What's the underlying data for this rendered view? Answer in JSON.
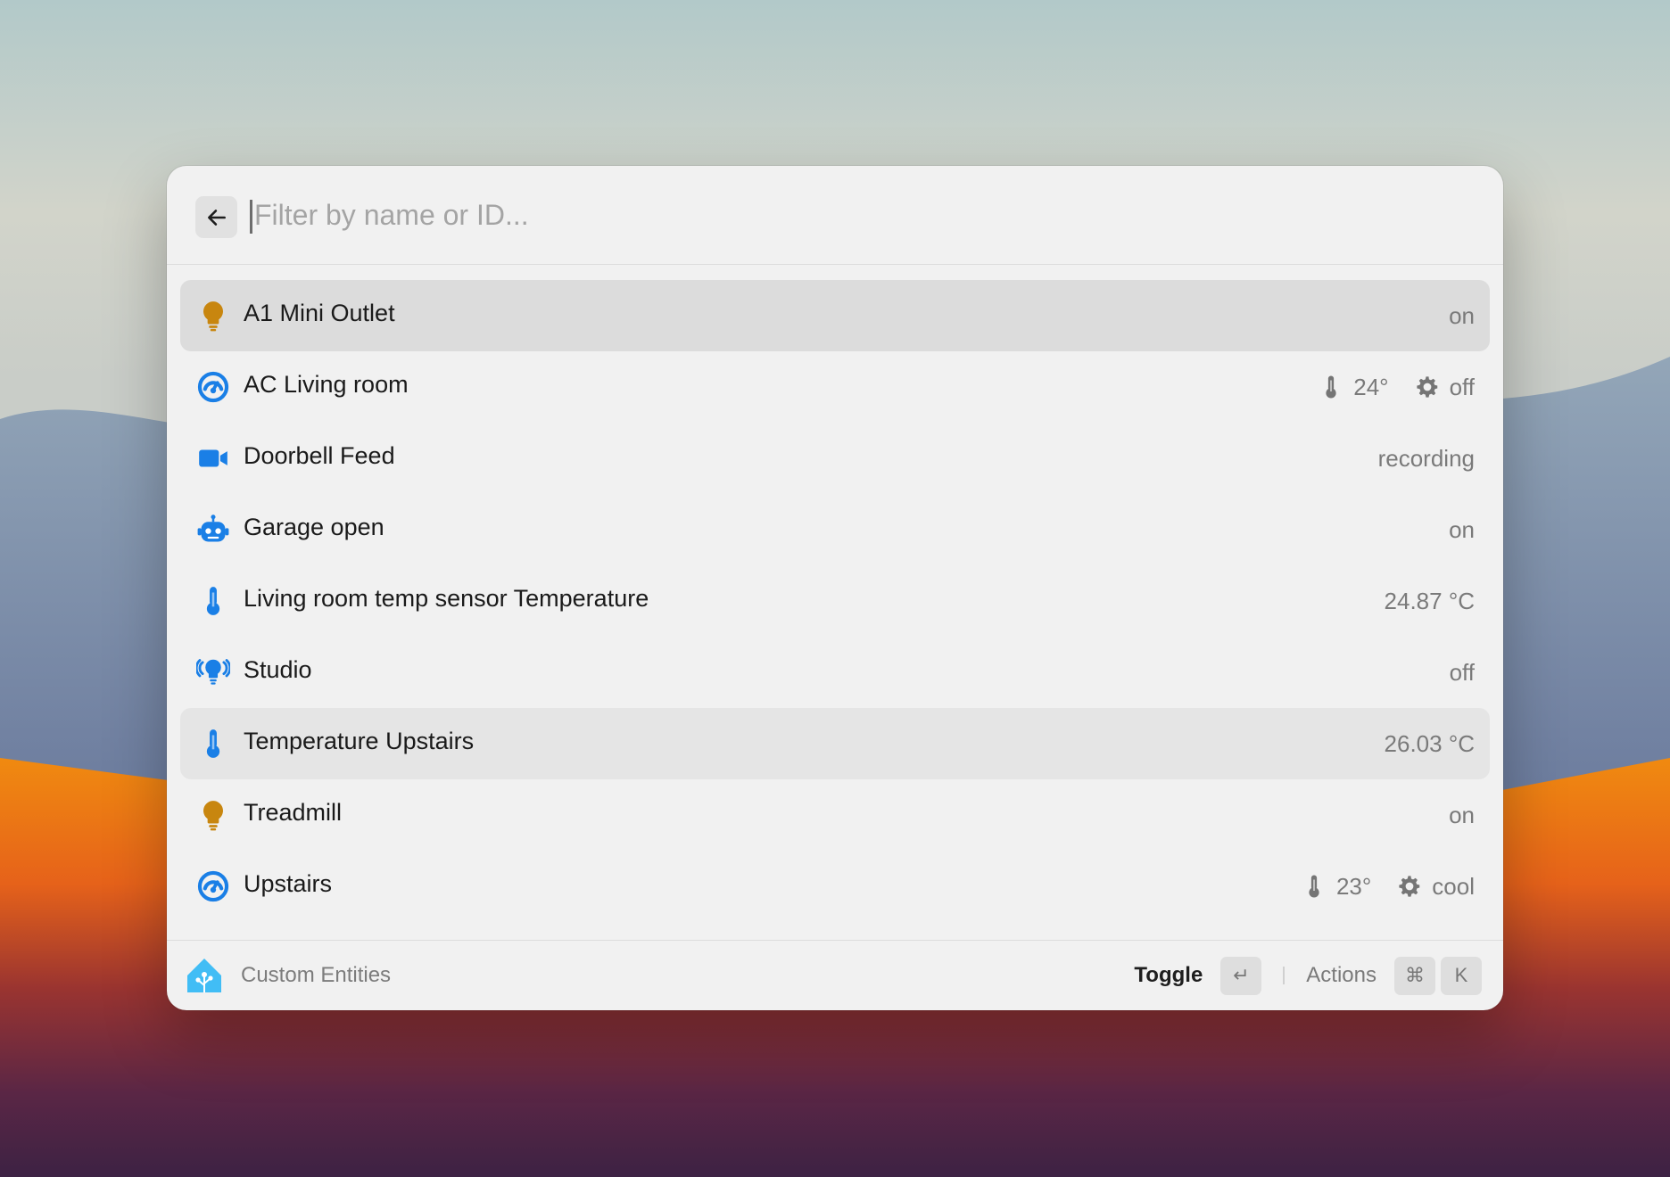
{
  "search": {
    "placeholder": "Filter by name or ID...",
    "value": ""
  },
  "entities": [
    {
      "name": "A1 Mini Outlet",
      "icon": "lightbulb-icon",
      "icon_color": "#c8860f",
      "state": "on",
      "accessories": [],
      "selected": true
    },
    {
      "name": "AC Living room",
      "icon": "climate-icon",
      "icon_color": "#1a7fe6",
      "state": "off",
      "accessories": [
        {
          "icon": "thermometer-icon",
          "text": "24°"
        },
        {
          "icon": "gear-icon",
          "text": "off"
        }
      ]
    },
    {
      "name": "Doorbell Feed",
      "icon": "video-camera-icon",
      "icon_color": "#1a7fe6",
      "state": "recording",
      "accessories": []
    },
    {
      "name": "Garage open",
      "icon": "robot-icon",
      "icon_color": "#1a7fe6",
      "state": "on",
      "accessories": []
    },
    {
      "name": "Living room temp sensor Temperature",
      "icon": "thermometer-icon",
      "icon_color": "#1a7fe6",
      "state": "24.87 °C",
      "accessories": []
    },
    {
      "name": "Studio",
      "icon": "lightbulb-group-icon",
      "icon_color": "#1a7fe6",
      "state": "off",
      "accessories": []
    },
    {
      "name": "Temperature Upstairs",
      "icon": "thermometer-icon",
      "icon_color": "#1a7fe6",
      "state": "26.03 °C",
      "accessories": [],
      "hovered": true
    },
    {
      "name": "Treadmill",
      "icon": "lightbulb-icon",
      "icon_color": "#c8860f",
      "state": "on",
      "accessories": []
    },
    {
      "name": "Upstairs",
      "icon": "climate-icon",
      "icon_color": "#1a7fe6",
      "state": "cool",
      "accessories": [
        {
          "icon": "thermometer-icon",
          "text": "23°"
        },
        {
          "icon": "gear-icon",
          "text": "cool"
        }
      ]
    }
  ],
  "footer": {
    "title": "Custom Entities",
    "logo_icon": "home-assistant-icon",
    "primary_action": "Toggle",
    "primary_key": "↵",
    "secondary_action": "Actions",
    "secondary_keys": [
      "⌘",
      "K"
    ]
  },
  "colors": {
    "accent_blue": "#1a7fe6",
    "bulb_amber": "#c8860f",
    "logo_blue": "#41bdf5"
  }
}
